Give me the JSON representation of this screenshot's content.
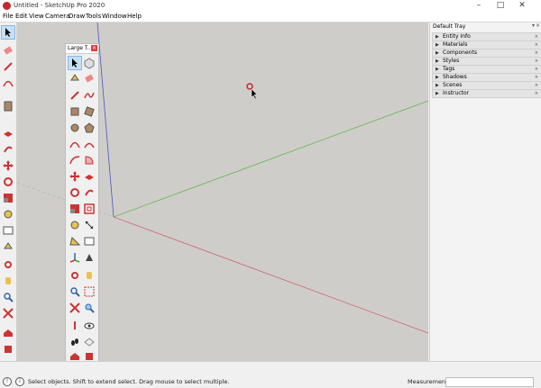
{
  "window": {
    "title": "Untitled - SketchUp Pro 2020",
    "minimize_icon": "minimize-icon",
    "maximize_icon": "maximize-icon",
    "close_icon": "close-icon"
  },
  "menu": [
    "File",
    "Edit",
    "View",
    "Camera",
    "Draw",
    "Tools",
    "Window",
    "Help"
  ],
  "large_toolset": {
    "title": "Large T..."
  },
  "tray": {
    "title": "Default Tray",
    "panels": [
      "Entity Info",
      "Materials",
      "Components",
      "Styles",
      "Tags",
      "Shadows",
      "Scenes",
      "Instructor"
    ]
  },
  "status": {
    "message": "Select objects. Shift to extend select. Drag mouse to select multiple.",
    "measurements_label": "Measurements",
    "measurements_value": ""
  },
  "colors": {
    "red_axis": "#c9646e",
    "green_axis": "#5cb84a",
    "blue_axis": "#4a55c6",
    "accent": "#c8262c"
  }
}
